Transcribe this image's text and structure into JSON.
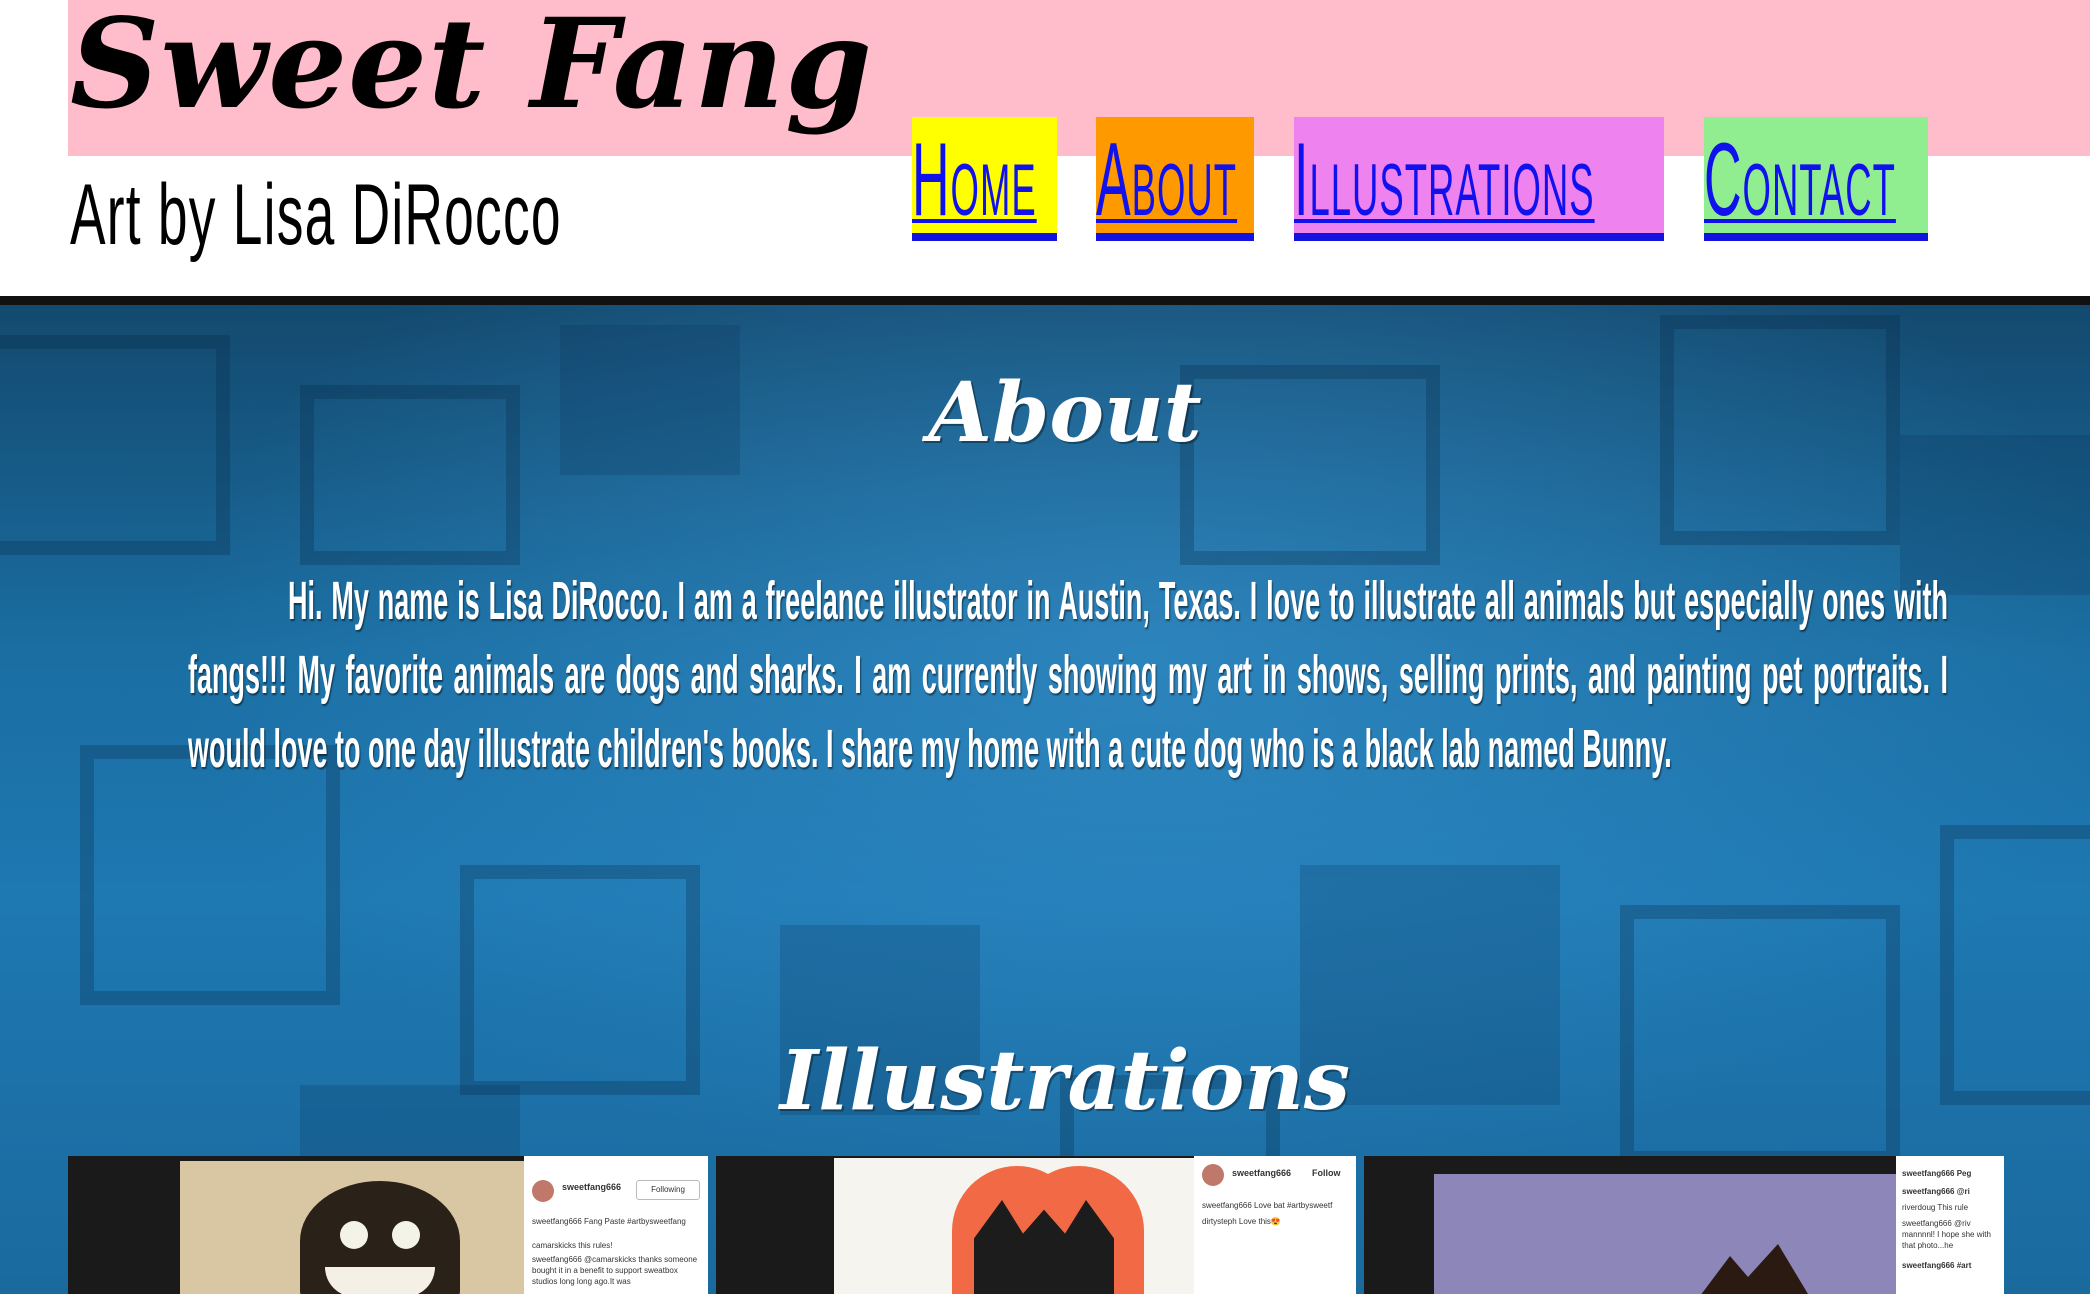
{
  "header": {
    "title": "Sweet Fang",
    "subtitle": "Art by Lisa DiRocco"
  },
  "nav": {
    "items": [
      {
        "label": "Home",
        "color": "#ffff00"
      },
      {
        "label": "About",
        "color": "#ff9900"
      },
      {
        "label": "Illustrations",
        "color": "#ee82ee"
      },
      {
        "label": "Contact",
        "color": "#90ee90"
      }
    ],
    "link_color": "#1111ee"
  },
  "about": {
    "heading": "About",
    "body": "Hi. My name is Lisa DiRocco. I am a freelance illustrator in Austin, Texas. I love to illustrate all animals but especially ones with fangs!!! My favorite animals are dogs and sharks. I am currently showing my art in shows, selling prints, and painting pet portraits. I would love to one day illustrate children's books. I share my home with a cute dog who is a black lab named Bunny."
  },
  "illustrations": {
    "heading": "Illustrations",
    "items": [
      {
        "subject": "fanged monster drawing",
        "user": "sweetfang666",
        "follow_label": "Following",
        "caption": "sweetfang666 Fang Paste #artbysweetfang",
        "comment1": "camarskicks this rules!",
        "comment2": "sweetfang666 @camarskicks thanks someone bought it in a benefit to support sweatbox studios long long ago.It was"
      },
      {
        "subject": "bat on a red heart",
        "user": "sweetfang666",
        "follow_label": "Follow",
        "caption": "sweetfang666 Love bat #artbysweetf",
        "comment1": "dirtysteph Love this😍"
      },
      {
        "subject": "creature on purple background",
        "caption": "sweetfang666 Peg",
        "comment1": "sweetfang666 @ri",
        "comment2": "riverdoug This rule",
        "comment3": "sweetfang666 @riv mannnnl! I hope she with that photo...he",
        "comment4": "sweetfang666 #art"
      }
    ]
  },
  "colors": {
    "header_band": "#ffbccb",
    "background": "#1e78b2",
    "text": "#ffffff"
  }
}
